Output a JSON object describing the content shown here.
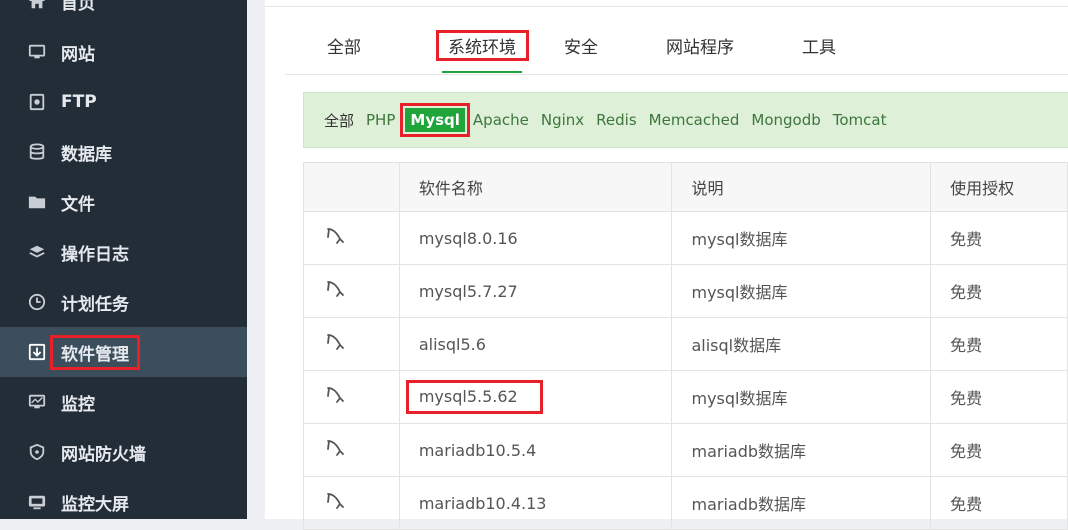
{
  "sidebar": {
    "items": [
      {
        "label": "首页",
        "icon": "home-icon"
      },
      {
        "label": "网站",
        "icon": "monitor-icon"
      },
      {
        "label": "FTP",
        "icon": "ftp-icon"
      },
      {
        "label": "数据库",
        "icon": "database-icon"
      },
      {
        "label": "文件",
        "icon": "folder-icon"
      },
      {
        "label": "操作日志",
        "icon": "layers-icon"
      },
      {
        "label": "计划任务",
        "icon": "clock-icon"
      },
      {
        "label": "软件管理",
        "icon": "download-box-icon",
        "active": true
      },
      {
        "label": "监控",
        "icon": "chart-monitor-icon"
      },
      {
        "label": "网站防火墙",
        "icon": "shield-icon"
      },
      {
        "label": "监控大屏",
        "icon": "screen-icon"
      }
    ]
  },
  "tabs": [
    {
      "label": "全部"
    },
    {
      "label": "系统环境",
      "active": true
    },
    {
      "label": "安全"
    },
    {
      "label": "网站程序"
    },
    {
      "label": "工具"
    }
  ],
  "filters": [
    "全部",
    "PHP",
    "Mysql",
    "Apache",
    "Nginx",
    "Redis",
    "Memcached",
    "Mongodb",
    "Tomcat"
  ],
  "active_filter": "Mysql",
  "table": {
    "headers": [
      "",
      "软件名称",
      "说明",
      "使用授权"
    ],
    "rows": [
      {
        "name": "mysql8.0.16",
        "desc": "mysql数据库",
        "license": "免费"
      },
      {
        "name": "mysql5.7.27",
        "desc": "mysql数据库",
        "license": "免费"
      },
      {
        "name": "alisql5.6",
        "desc": "alisql数据库",
        "license": "免费"
      },
      {
        "name": "mysql5.5.62",
        "desc": "mysql数据库",
        "license": "免费",
        "highlighted": true
      },
      {
        "name": "mariadb10.5.4",
        "desc": "mariadb数据库",
        "license": "免费"
      },
      {
        "name": "mariadb10.4.13",
        "desc": "mariadb数据库",
        "license": "免费"
      }
    ]
  },
  "colors": {
    "sidebar_bg": "#232d38",
    "accent": "#20a53a",
    "highlight": "#e8202a"
  }
}
